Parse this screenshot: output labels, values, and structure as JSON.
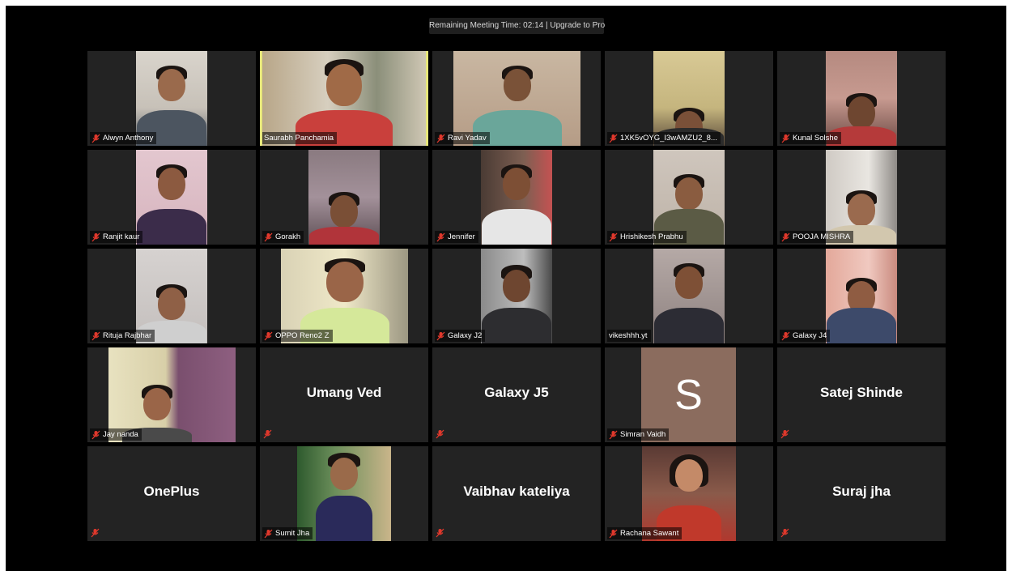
{
  "banner": {
    "text": "Remaining Meeting Time: 02:14 | Upgrade to Pro"
  },
  "colors": {
    "background": "#000000",
    "tile": "#232323",
    "active_speaker_border": "#e6e67a",
    "muted_icon": "#e0382c",
    "avatar_bg": "#8b6c5e"
  },
  "participants": [
    {
      "name": "Alwyn Anthony",
      "muted": true
    },
    {
      "name": "Saurabh Panchamia",
      "muted": false,
      "active_speaker": true
    },
    {
      "name": "Ravi Yadav",
      "muted": true
    },
    {
      "name": "1XK5vOYG_I3wAMZU2_8...",
      "muted": true
    },
    {
      "name": "Kunal Solshe",
      "muted": true
    },
    {
      "name": "Ranjit kaur",
      "muted": true
    },
    {
      "name": "Gorakh",
      "muted": true
    },
    {
      "name": "Jennifer",
      "muted": true
    },
    {
      "name": "Hrishikesh Prabhu",
      "muted": true
    },
    {
      "name": "POOJA MISHRA",
      "muted": true
    },
    {
      "name": "Rituja Rajbhar",
      "muted": true
    },
    {
      "name": "OPPO Reno2 Z",
      "muted": true
    },
    {
      "name": "Galaxy J2",
      "muted": true
    },
    {
      "name": "vikeshhh.yt",
      "muted": false
    },
    {
      "name": "Galaxy J4",
      "muted": true
    },
    {
      "name": "Jay nanda",
      "muted": true
    },
    {
      "name": "Umang Ved",
      "muted": true,
      "video": false
    },
    {
      "name": "Galaxy J5",
      "muted": true,
      "video": false
    },
    {
      "name": "Simran Vaidh",
      "muted": true,
      "avatar_letter": "S"
    },
    {
      "name": "Satej Shinde",
      "muted": true,
      "video": false
    },
    {
      "name": "OnePlus",
      "muted": true,
      "video": false
    },
    {
      "name": "Sumit Jha",
      "muted": true
    },
    {
      "name": "Vaibhav kateliya",
      "muted": true,
      "video": false
    },
    {
      "name": "Rachana Sawant",
      "muted": true
    },
    {
      "name": "Suraj jha",
      "muted": true,
      "video": false
    }
  ]
}
